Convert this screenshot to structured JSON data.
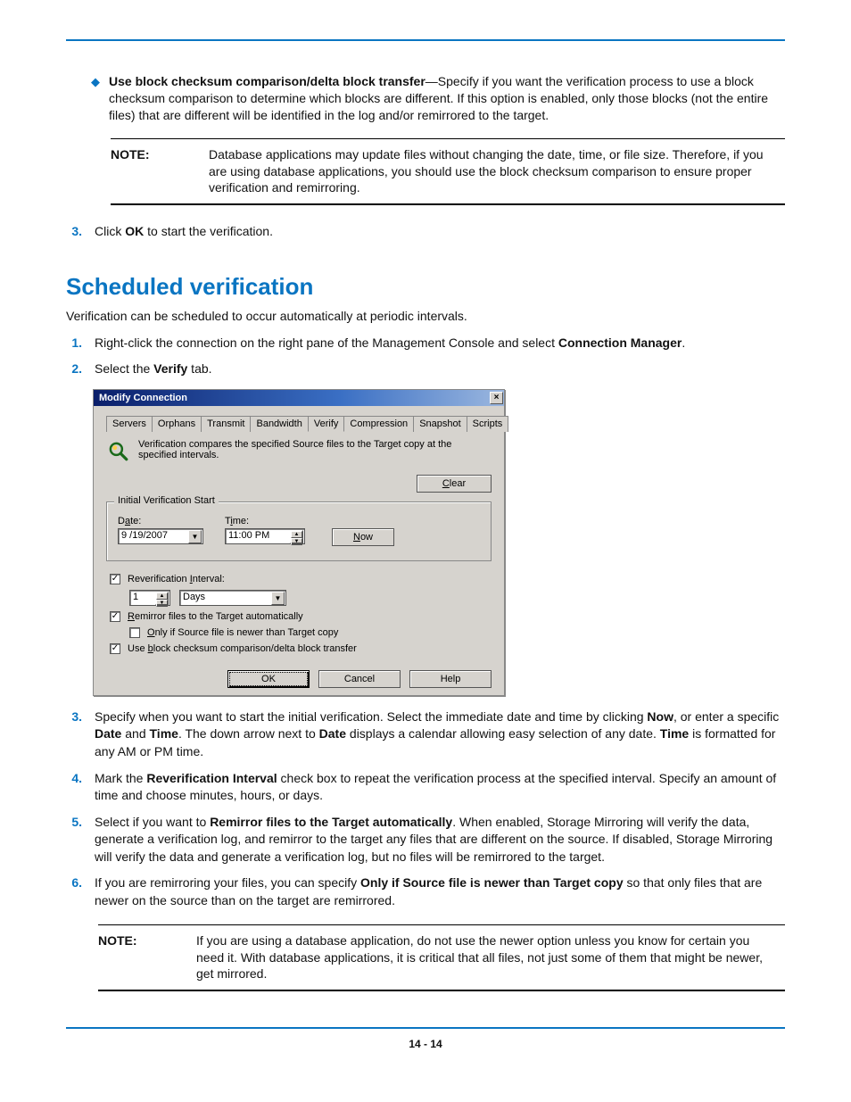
{
  "pageNumber": "14 - 14",
  "topBullet": {
    "boldLead": "Use block checksum comparison/delta block transfer",
    "rest": "—Specify if you want the verification process to use a block checksum comparison to determine which blocks are different. If this option is enabled, only those blocks (not the entire files) that are different will be identified in the log and/or remirrored to the target."
  },
  "note1": {
    "label": "NOTE:",
    "text": "Database applications may update files without changing the date, time, or file size. Therefore, if you are using database applications, you should use the block checksum comparison to ensure proper verification and remirroring."
  },
  "step3top": {
    "num": "3.",
    "pre": "Click ",
    "bold": "OK",
    "post": " to start the verification."
  },
  "sectionTitle": "Scheduled verification",
  "intro": "Verification can be scheduled to occur automatically at periodic intervals.",
  "steps": {
    "s1": {
      "num": "1.",
      "pre": "Right-click the connection on the right pane of the Management Console and select ",
      "bold": "Connection Manager",
      "post": "."
    },
    "s2": {
      "num": "2.",
      "pre": "Select the ",
      "bold": "Verify",
      "post": " tab."
    },
    "s3": {
      "num": "3.",
      "t1": "Specify when you want to start the initial verification. Select the immediate date and time by clicking ",
      "b1": "Now",
      "t2": ", or enter a specific ",
      "b2": "Date",
      "t3": " and ",
      "b3": "Time",
      "t4": ". The down arrow next to ",
      "b4": "Date",
      "t5": " displays a calendar allowing easy selection of any date. ",
      "b5": "Time",
      "t6": " is formatted for any AM or PM time."
    },
    "s4": {
      "num": "4.",
      "pre": "Mark the ",
      "bold": "Reverification Interval",
      "post": " check box to repeat the verification process at the specified interval. Specify an amount of time and choose minutes, hours, or days."
    },
    "s5": {
      "num": "5.",
      "pre": "Select if you want to ",
      "bold": "Remirror files to the Target automatically",
      "post": ". When enabled, Storage Mirroring will verify the data, generate a verification log, and remirror to the target any files that are different on the source. If disabled, Storage Mirroring will verify the data and generate a verification log, but no files will be remirrored to the target."
    },
    "s6": {
      "num": "6.",
      "pre": "If you are remirroring your files, you can specify ",
      "bold": "Only if Source file is newer than Target copy",
      "post": " so that only files that are newer on the source than on the target are remirrored."
    }
  },
  "note2": {
    "label": "NOTE:",
    "text": "If you are using a database application, do not use the newer option unless you know for certain you need it. With database applications, it is critical that all files, not just some of them that might be newer, get mirrored."
  },
  "dialog": {
    "title": "Modify Connection",
    "closeGlyph": "×",
    "tabs": {
      "servers": "Servers",
      "orphans": "Orphans",
      "transmit": "Transmit",
      "bandwidth": "Bandwidth",
      "verify": "Verify",
      "compression": "Compression",
      "snapshot": "Snapshot",
      "scripts": "Scripts"
    },
    "description": "Verification compares the specified Source files to the Target copy at the specified intervals.",
    "clear": "Clear",
    "fieldsetLegend": "Initial Verification Start",
    "dateLabel": "Date:",
    "dateValue": "9 /19/2007",
    "timeLabel": "Time:",
    "timeValue": "11:00 PM",
    "nowLabel": "Now",
    "reverifLabel": "Reverification Interval:",
    "reverifValue": "1",
    "reverifUnit": "Days",
    "remirrorLabel": "Remirror files to the Target automatically",
    "onlyNewerLabel": "Only if Source file is newer than Target copy",
    "blockChecksumLabel": "Use block checksum comparison/delta block transfer",
    "ok": "OK",
    "cancel": "Cancel",
    "help": "Help",
    "checkOn": "✓"
  }
}
